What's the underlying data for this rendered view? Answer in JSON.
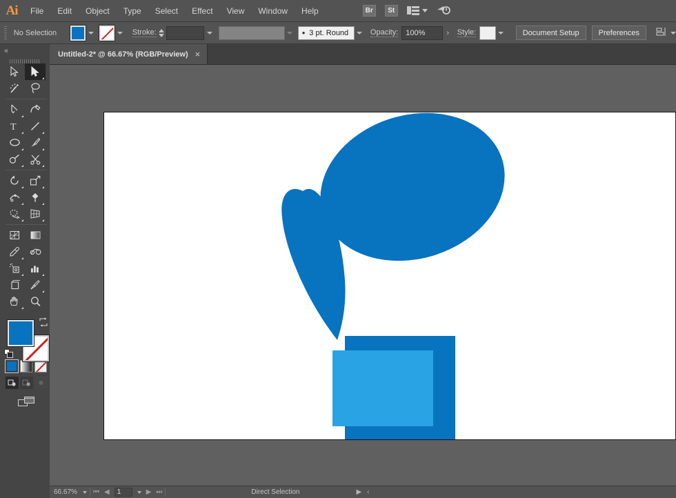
{
  "app": {
    "name": "Ai",
    "logo_text": "Ai"
  },
  "menubar": {
    "items": [
      {
        "label": "File"
      },
      {
        "label": "Edit"
      },
      {
        "label": "Object"
      },
      {
        "label": "Type"
      },
      {
        "label": "Select"
      },
      {
        "label": "Effect"
      },
      {
        "label": "View"
      },
      {
        "label": "Window"
      },
      {
        "label": "Help"
      }
    ],
    "bridge_label": "Br",
    "stock_label": "St",
    "workspace_icon": "workspace-switcher-icon",
    "search_icon": "search-adobe-icon"
  },
  "controlbar": {
    "selection_status": "No Selection",
    "fill_color": "#0873bf",
    "fill_icon": "fill-swatch-icon",
    "stroke_swatch_icon": "stroke-none-swatch-icon",
    "stroke_label": "Stroke:",
    "stroke_weight": "",
    "width_profile": "",
    "brush_definition": "3 pt. Round",
    "opacity_label": "Opacity:",
    "opacity_value": "100%",
    "style_label": "Style:",
    "style_value": "",
    "document_setup": "Document Setup",
    "preferences": "Preferences",
    "align_icon": "align-objects-icon"
  },
  "tabbar": {
    "document_title": "Untitled-2* @ 66.67% (RGB/Preview)",
    "close_icon": "×"
  },
  "leftpanel": {
    "collapse_icon": "«"
  },
  "toolbar": {
    "tools": [
      {
        "name": "selection-tool",
        "label": "Selection",
        "active": false,
        "corner": false
      },
      {
        "name": "direct-selection-tool",
        "label": "Direct Selection",
        "active": true,
        "corner": true
      },
      {
        "name": "magic-wand-tool",
        "label": "Magic Wand",
        "active": false,
        "corner": false
      },
      {
        "name": "lasso-tool",
        "label": "Lasso",
        "active": false,
        "corner": false
      },
      {
        "name": "pen-tool",
        "label": "Pen",
        "active": false,
        "corner": true
      },
      {
        "name": "curvature-tool",
        "label": "Curvature",
        "active": false,
        "corner": false
      },
      {
        "name": "type-tool",
        "label": "Type",
        "active": false,
        "corner": true
      },
      {
        "name": "line-segment-tool",
        "label": "Line Segment",
        "active": false,
        "corner": true
      },
      {
        "name": "ellipse-tool",
        "label": "Ellipse",
        "active": false,
        "corner": true
      },
      {
        "name": "paintbrush-tool",
        "label": "Paintbrush",
        "active": false,
        "corner": true
      },
      {
        "name": "shaper-tool",
        "label": "Shaper",
        "active": false,
        "corner": true
      },
      {
        "name": "scissors-tool",
        "label": "Scissors",
        "active": false,
        "corner": true
      },
      {
        "name": "rotate-tool",
        "label": "Rotate",
        "active": false,
        "corner": true
      },
      {
        "name": "scale-tool",
        "label": "Scale",
        "active": false,
        "corner": true
      },
      {
        "name": "width-tool",
        "label": "Width",
        "active": false,
        "corner": true
      },
      {
        "name": "free-transform-tool",
        "label": "Free Transform",
        "active": false,
        "corner": true
      },
      {
        "name": "shape-builder-tool",
        "label": "Shape Builder",
        "active": false,
        "corner": true
      },
      {
        "name": "perspective-grid-tool",
        "label": "Perspective Grid",
        "active": false,
        "corner": true
      },
      {
        "name": "mesh-tool",
        "label": "Mesh",
        "active": false,
        "corner": false
      },
      {
        "name": "gradient-tool",
        "label": "Gradient",
        "active": false,
        "corner": false
      },
      {
        "name": "eyedropper-tool",
        "label": "Eyedropper",
        "active": false,
        "corner": true
      },
      {
        "name": "blend-tool",
        "label": "Blend",
        "active": false,
        "corner": false
      },
      {
        "name": "symbol-sprayer-tool",
        "label": "Symbol Sprayer",
        "active": false,
        "corner": true
      },
      {
        "name": "column-graph-tool",
        "label": "Column Graph",
        "active": false,
        "corner": true
      },
      {
        "name": "artboard-tool",
        "label": "Artboard",
        "active": false,
        "corner": false
      },
      {
        "name": "slice-tool",
        "label": "Slice",
        "active": false,
        "corner": true
      },
      {
        "name": "hand-tool",
        "label": "Hand",
        "active": false,
        "corner": true
      },
      {
        "name": "zoom-tool",
        "label": "Zoom",
        "active": false,
        "corner": false
      }
    ],
    "fill_color": "#0873bf",
    "stroke_color": "none",
    "swap_icon": "swap-fill-stroke-icon",
    "default_icon": "default-fill-stroke-icon",
    "color_mode": "color",
    "gradient_mode_icon": "gradient-icon",
    "none_mode_icon": "none-icon",
    "draw_modes": [
      "draw-normal",
      "draw-behind",
      "draw-inside"
    ],
    "screen_mode_icon": "change-screen-mode-icon"
  },
  "canvas": {
    "background": "#606060",
    "artboard_background": "#ffffff",
    "artwork": {
      "shapes": [
        {
          "name": "blue-blob-ellipse",
          "type": "ellipse",
          "color": "#0873bf"
        },
        {
          "name": "blue-leaf-shape",
          "type": "path",
          "color": "#0873bf"
        },
        {
          "name": "dark-blue-rect",
          "type": "rect",
          "color": "#0873bf"
        },
        {
          "name": "light-blue-rect",
          "type": "rect",
          "color": "#2aa3e4"
        }
      ]
    }
  },
  "statusbar": {
    "zoom_level": "66.67%",
    "page_number": "1",
    "current_tool": "Direct Selection"
  }
}
